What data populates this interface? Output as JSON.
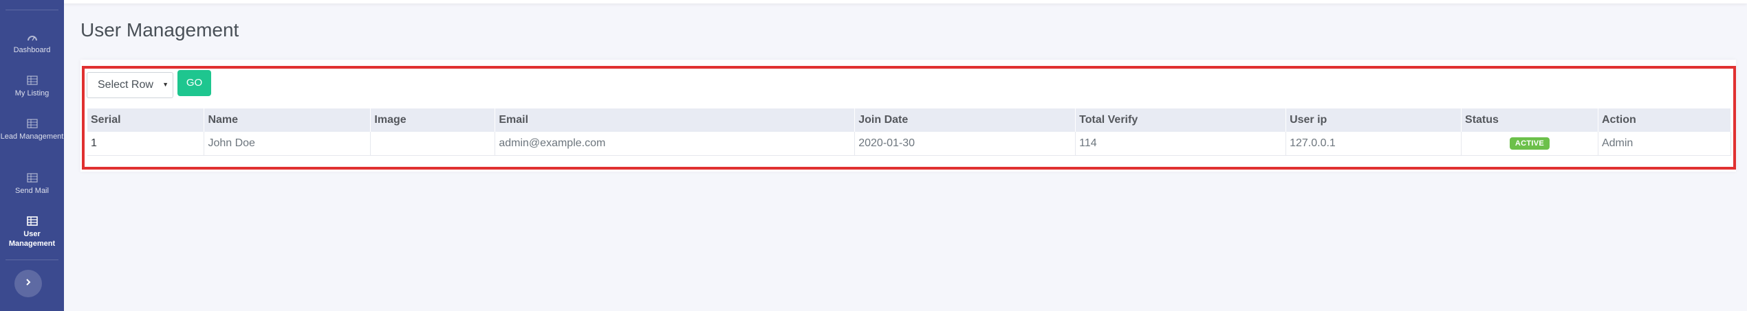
{
  "sidebar": {
    "items": [
      {
        "label": "Dashboard",
        "icon": "dashboard-icon"
      },
      {
        "label": "My Listing",
        "icon": "grid-icon"
      },
      {
        "label": "Lead Management",
        "icon": "grid-icon"
      },
      {
        "label": "Send Mail",
        "icon": "grid-icon"
      },
      {
        "label": "User Management",
        "icon": "table-icon",
        "active": true
      }
    ],
    "toggle_icon": "chevron-right-icon"
  },
  "page": {
    "title": "User Management"
  },
  "controls": {
    "select_placeholder": "Select Row",
    "go_label": "GO"
  },
  "table": {
    "headers": [
      "Serial",
      "Name",
      "Image",
      "Email",
      "Join Date",
      "Total Verify",
      "User ip",
      "Status",
      "Action"
    ],
    "rows": [
      {
        "serial": "1",
        "name": "John Doe",
        "image": "",
        "email": "admin@example.com",
        "join_date": "2020-01-30",
        "total_verify": "114",
        "user_ip": "127.0.0.1",
        "status": "ACTIVE",
        "action": "Admin"
      }
    ]
  },
  "colors": {
    "sidebar_bg": "#3b4a8f",
    "accent_green": "#1ec68f",
    "status_active": "#6cc04a",
    "highlight_border": "#e03131"
  }
}
